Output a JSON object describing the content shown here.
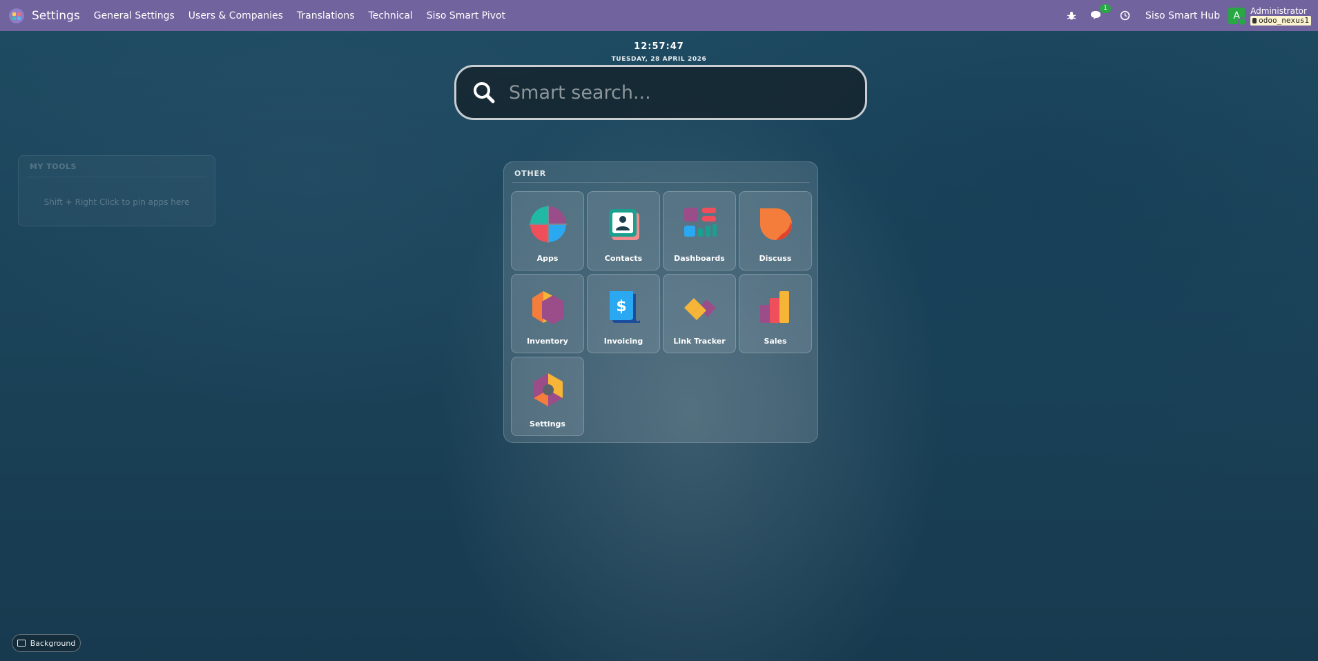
{
  "navbar": {
    "brand": "Settings",
    "menu": [
      "General Settings",
      "Users & Companies",
      "Translations",
      "Technical",
      "Siso Smart Pivot"
    ],
    "notification_count": "1",
    "hub_label": "Siso Smart Hub",
    "avatar_initial": "A",
    "user_name": "Administrator",
    "db_name": "odoo_nexus1"
  },
  "clock": {
    "time": "12:57:47",
    "date": "TUESDAY, 28 APRIL 2026"
  },
  "search": {
    "placeholder": "Smart search..."
  },
  "my_tools": {
    "title": "MY TOOLS",
    "hint": "Shift + Right Click to pin apps here"
  },
  "apps_section": {
    "title": "OTHER",
    "apps": [
      {
        "label": "Apps",
        "icon": "apps-icon"
      },
      {
        "label": "Contacts",
        "icon": "contacts-icon"
      },
      {
        "label": "Dashboards",
        "icon": "dashboards-icon"
      },
      {
        "label": "Discuss",
        "icon": "discuss-icon"
      },
      {
        "label": "Inventory",
        "icon": "inventory-icon"
      },
      {
        "label": "Invoicing",
        "icon": "invoicing-icon"
      },
      {
        "label": "Link Tracker",
        "icon": "link-tracker-icon"
      },
      {
        "label": "Sales",
        "icon": "sales-icon"
      },
      {
        "label": "Settings",
        "icon": "settings-icon"
      }
    ]
  },
  "background_button": {
    "label": "Background"
  },
  "colors": {
    "navbar": "#71639e",
    "badge": "#28a745",
    "avatar": "#27a843"
  }
}
